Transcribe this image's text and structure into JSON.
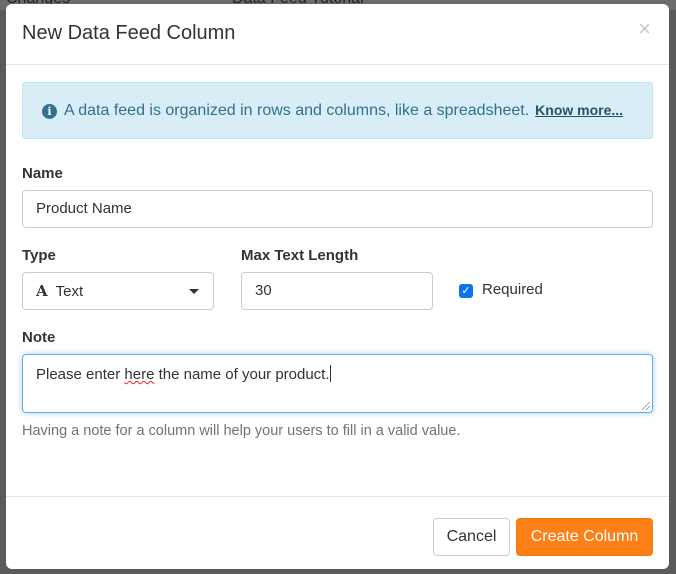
{
  "background": {
    "left_text": "Changes",
    "right_text": "Data Feed Tutorial"
  },
  "modal": {
    "title": "New Data Feed Column",
    "close_glyph": "×"
  },
  "alert": {
    "icon": "info-icon",
    "text": "A data feed is organized in rows and columns, like a spreadsheet.",
    "link": "Know more..."
  },
  "form": {
    "name_label": "Name",
    "name_value": "Product Name",
    "type_label": "Type",
    "type_icon": "text-type-icon",
    "type_value": "Text",
    "max_length_label": "Max Text Length",
    "max_length_value": "30",
    "required_label": "Required",
    "required_checked": true,
    "note_label": "Note",
    "note_value_before": "Please enter ",
    "note_value_typo": "here",
    "note_value_after": " the name of your product.",
    "note_help": "Having a note for a column will help your users to fill in a valid value."
  },
  "footer": {
    "cancel_label": "Cancel",
    "create_label": "Create Column"
  },
  "colors": {
    "accent": "#fd7f17",
    "info_bg": "#d9edf7",
    "checkbox": "#0a74e8"
  }
}
